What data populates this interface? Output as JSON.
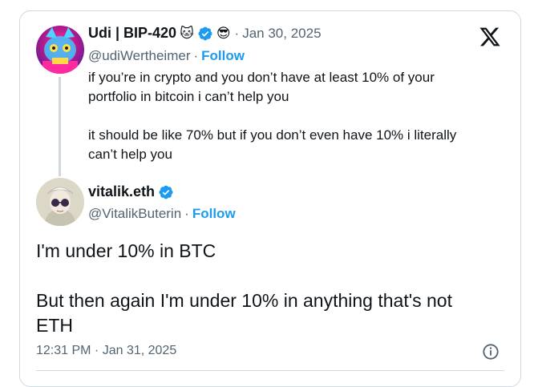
{
  "parent_tweet": {
    "display_name": "Udi | BIP-420",
    "name_emoji_1": "🐱",
    "name_emoji_2": "😎",
    "date": "Jan 30, 2025",
    "handle": "@udiWertheimer",
    "follow_label": "Follow",
    "text_lines": [
      "if you’re in crypto and you don’t have at least 10% of your",
      "portfolio in bitcoin i can’t help you",
      "",
      "it should be like 70% but if you don’t even have 10% i literally",
      "can’t help you"
    ]
  },
  "main_tweet": {
    "display_name": "vitalik.eth",
    "handle": "@VitalikButerin",
    "follow_label": "Follow",
    "text_lines": [
      "I'm under 10% in BTC",
      "",
      "But then again I'm under 10% in anything that's not",
      "ETH"
    ],
    "timestamp": "12:31 PM · Jan 31, 2025"
  },
  "sep": "·",
  "colors": {
    "accent": "#1d9bf0",
    "muted": "#536471",
    "border": "#cfd9de",
    "text": "#0f1419"
  },
  "icons": [
    "x-logo-icon",
    "verified-badge-icon",
    "info-icon"
  ]
}
